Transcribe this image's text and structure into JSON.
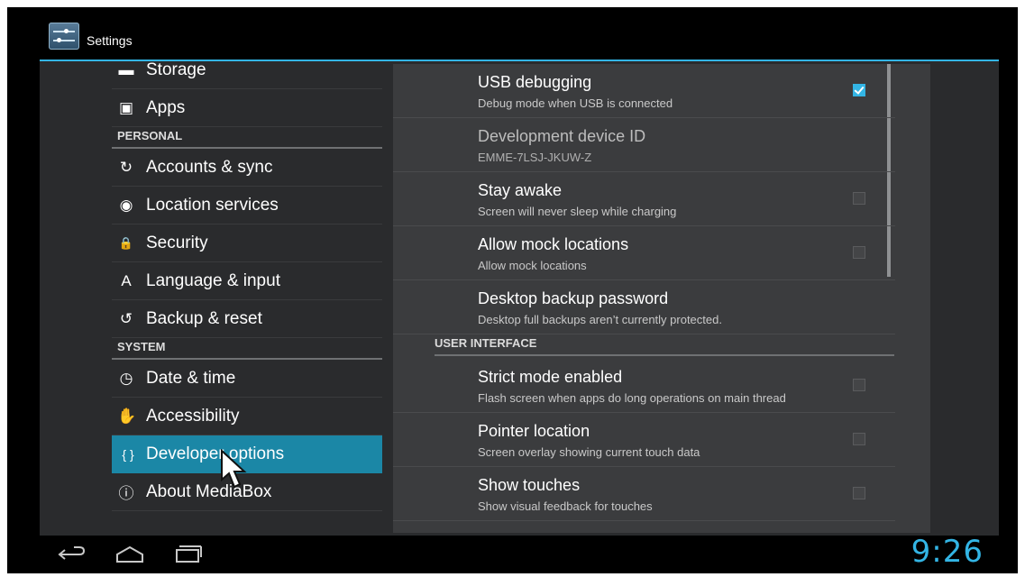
{
  "app": {
    "title": "Settings"
  },
  "left_pane": {
    "items": [
      {
        "type": "item",
        "label": "Storage",
        "icon": "storage-icon"
      },
      {
        "type": "item",
        "label": "Apps",
        "icon": "apps-icon"
      },
      {
        "type": "header",
        "label": "PERSONAL"
      },
      {
        "type": "item",
        "label": "Accounts & sync",
        "icon": "sync-icon"
      },
      {
        "type": "item",
        "label": "Location services",
        "icon": "location-icon"
      },
      {
        "type": "item",
        "label": "Security",
        "icon": "lock-icon"
      },
      {
        "type": "item",
        "label": "Language & input",
        "icon": "keyboard-icon"
      },
      {
        "type": "item",
        "label": "Backup & reset",
        "icon": "backup-icon"
      },
      {
        "type": "header",
        "label": "SYSTEM"
      },
      {
        "type": "item",
        "label": "Date & time",
        "icon": "clock-icon"
      },
      {
        "type": "item",
        "label": "Accessibility",
        "icon": "hand-icon"
      },
      {
        "type": "item",
        "label": "Developer options",
        "icon": "braces-icon",
        "selected": true
      },
      {
        "type": "item",
        "label": "About MediaBox",
        "icon": "info-icon"
      }
    ]
  },
  "right_pane": {
    "prefs": [
      {
        "title": "USB debugging",
        "summary": "Debug mode when USB is connected",
        "checkbox": true,
        "checked": true
      },
      {
        "title": "Development device ID",
        "summary": "EMME-7LSJ-JKUW-Z",
        "disabled": true
      },
      {
        "title": "Stay awake",
        "summary": "Screen will never sleep while charging",
        "checkbox": true,
        "checked": false
      },
      {
        "title": "Allow mock locations",
        "summary": "Allow mock locations",
        "checkbox": true,
        "checked": false
      },
      {
        "title": "Desktop backup password",
        "summary": "Desktop full backups aren’t currently protected."
      }
    ],
    "section_header": "USER INTERFACE",
    "ui_prefs": [
      {
        "title": "Strict mode enabled",
        "summary": "Flash screen when apps do long operations on main thread",
        "checkbox": true,
        "checked": false
      },
      {
        "title": "Pointer location",
        "summary": "Screen overlay showing current touch data",
        "checkbox": true,
        "checked": false
      },
      {
        "title": "Show touches",
        "summary": "Show visual feedback for touches",
        "checkbox": true,
        "checked": false
      }
    ]
  },
  "navbar": {
    "buttons": [
      "back-icon",
      "home-icon",
      "recent-apps-icon"
    ],
    "clock": "9:26"
  },
  "colors": {
    "accent": "#33b5e5",
    "selected_item": "#1b87a6"
  }
}
